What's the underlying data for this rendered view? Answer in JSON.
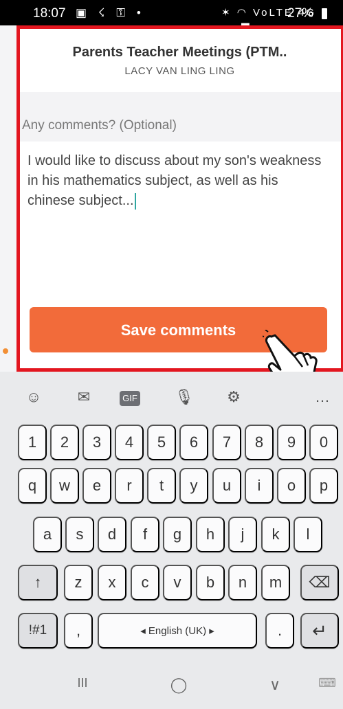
{
  "status_bar": {
    "time": "18:07",
    "left_icons": "▣ ☇ ⚿ •",
    "right_icons": "✶ ◠ VoLTE 4G ▂▃▅",
    "battery": "27%",
    "battery_icon": "battery-icon"
  },
  "header": {
    "title": "Parents Teacher Meetings (PTM..",
    "subtitle": "LACY VAN LING LING"
  },
  "comments": {
    "label": "Any comments? (Optional)",
    "value": "I would like to discuss about my son's weakness in his mathematics subject, as well as his chinese subject..."
  },
  "save_button": {
    "label": "Save comments"
  },
  "keyboard": {
    "toolbar": [
      "☺",
      "✉",
      "GIF",
      "🎙",
      "⚙",
      "",
      "…"
    ],
    "toolbar_icons": [
      "emoji-icon",
      "sticker-icon",
      "gif-icon",
      "microphone-icon",
      "gear-icon",
      "text-icon",
      "more-icon"
    ],
    "row1": [
      "1",
      "2",
      "3",
      "4",
      "5",
      "6",
      "7",
      "8",
      "9",
      "0"
    ],
    "row2": [
      "q",
      "w",
      "e",
      "r",
      "t",
      "y",
      "u",
      "i",
      "o",
      "p"
    ],
    "row3": [
      "a",
      "s",
      "d",
      "f",
      "g",
      "h",
      "j",
      "k",
      "l"
    ],
    "row4": [
      "z",
      "x",
      "c",
      "v",
      "b",
      "n",
      "m"
    ],
    "shift_icon": "↑",
    "backspace_icon": "⌫",
    "symbols_key": "!#1",
    "comma_key": ",",
    "space_label": "◂ English (UK) ▸",
    "period_key": ".",
    "enter_icon": "↵"
  },
  "nav": {
    "recent_icon": "III",
    "home_icon": "◯",
    "back_icon": "∨",
    "keyboard_icon": "⌨"
  },
  "colors": {
    "accent_orange": "#f26b3a",
    "highlight_red": "#e3161f",
    "caret_teal": "#2fa6a0"
  }
}
